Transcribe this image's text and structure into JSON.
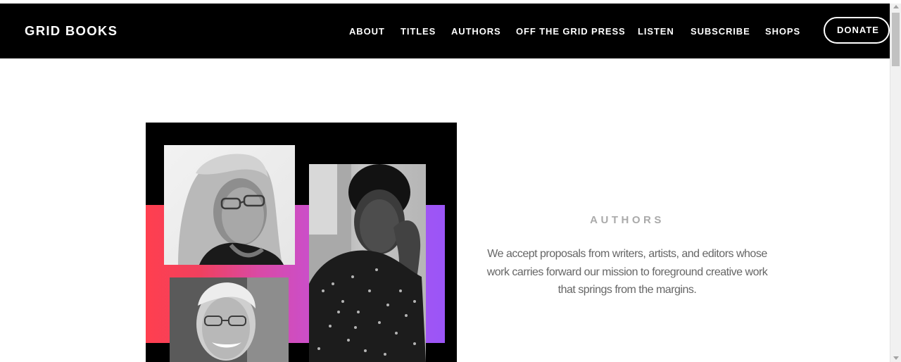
{
  "header": {
    "logo": "GRID BOOKS",
    "nav": [
      "ABOUT",
      "TITLES",
      "AUTHORS",
      "OFF THE GRID PRESS",
      "LISTEN",
      "SUBSCRIBE",
      "SHOPS"
    ],
    "donate_label": "DONATE"
  },
  "feature": {
    "heading": "AUTHORS",
    "body": "We accept proposals from writers, artists, and editors whose work carries forward our mission to foreground creative work that springs from the margins."
  },
  "colors": {
    "header_bg": "#000000",
    "band_left": "#ff3f4f",
    "band_mid": "#d94aa6",
    "band_right": "#9b55f7",
    "heading": "#aaaaaa",
    "body_text": "#666666"
  }
}
